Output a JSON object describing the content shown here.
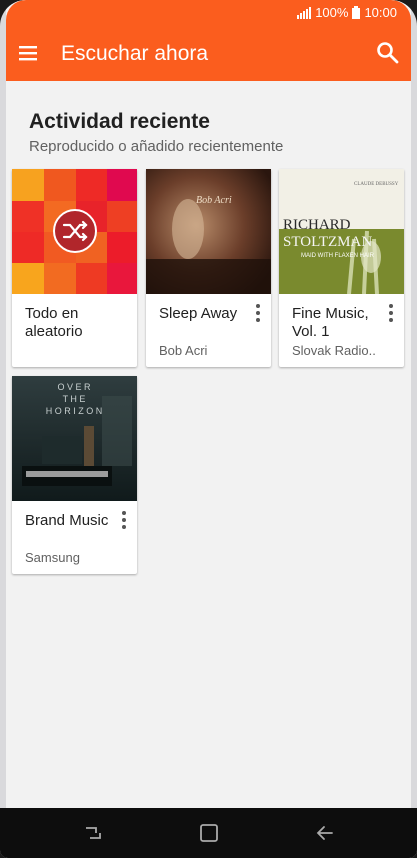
{
  "status": {
    "battery_percent": "100%",
    "time": "10:00"
  },
  "header": {
    "title": "Escuchar ahora"
  },
  "section": {
    "title": "Actividad reciente",
    "subtitle": "Reproducido o añadido recientemente"
  },
  "cards": [
    {
      "name": "Todo en aleatorio",
      "artist": ""
    },
    {
      "name": "Sleep Away",
      "artist": "Bob Acri"
    },
    {
      "name": "Fine Music, Vol. 1",
      "artist": "Slovak Radio.."
    },
    {
      "name": "Brand Music",
      "artist": "Samsung"
    }
  ],
  "album_art": {
    "richard": {
      "top": "CLAUDE DEBUSSY",
      "line1": "RICHARD",
      "line2": "STOLTZMAN",
      "line3": "MAID WITH FLAXEN HAIR"
    },
    "horizon": {
      "row1": "O V E R",
      "row2": "T H E",
      "row3": "H O R I Z O N"
    },
    "bob": {
      "sig": "Bob Acri"
    }
  },
  "colors": {
    "accent": "#fb5d1e"
  },
  "icons": [
    "menu-icon",
    "search-icon",
    "shuffle-icon",
    "more-vert-icon",
    "recents-icon",
    "home-icon",
    "back-icon",
    "signal-icon",
    "battery-icon"
  ]
}
